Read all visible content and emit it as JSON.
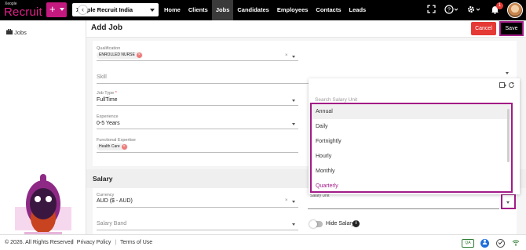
{
  "app": {
    "brand_small": "Xeople",
    "brand": "Recruit",
    "plus_label": "+",
    "org_selector": "Xeople Recruit India"
  },
  "nav": {
    "items": [
      {
        "label": "Home",
        "active": false
      },
      {
        "label": "Clients",
        "active": false
      },
      {
        "label": "Jobs",
        "active": true
      },
      {
        "label": "Candidates",
        "active": false
      },
      {
        "label": "Employees",
        "active": false
      },
      {
        "label": "Contacts",
        "active": false
      },
      {
        "label": "Leads",
        "active": false
      }
    ],
    "notification_count": "1",
    "icons": [
      "fullscreen-icon",
      "help-icon",
      "settings-icon",
      "bell-icon",
      "avatar"
    ]
  },
  "sidebar": {
    "jobs_label": "Jobs",
    "collapse_glyph": "‹"
  },
  "header": {
    "title": "Add Job",
    "cancel_label": "Cancel",
    "save_label": "Save"
  },
  "form": {
    "qualification_label": "Qualification",
    "qualification_chip": "ENROLLED NURSE",
    "skill_placeholder": "Skill",
    "job_type_label": "Job Type",
    "job_type_required": "*",
    "job_type_value": "FullTime",
    "experience_label": "Experience",
    "experience_value": "0-5 Years",
    "functional_expertise_label": "Functional Expertise",
    "functional_expertise_chip": "Health Care",
    "salary_section_title": "Salary",
    "currency_label": "Currency",
    "currency_value": "AUD ($ - AUD)",
    "salary_band_placeholder": "Salary Band",
    "salary_unit_label": "Salary Unit",
    "hide_salary_label": "Hide Salary",
    "clear_glyph": "×"
  },
  "dropdown": {
    "search_placeholder": "Search Salary Unit",
    "options": [
      "Annual",
      "Daily",
      "Fortnightly",
      "Hourly",
      "Monthly",
      "Quarterly"
    ],
    "highlighted": "Annual"
  },
  "footer": {
    "copyright": "© 2026. All Rights Reserved",
    "privacy": "Privacy Policy",
    "terms": "Terms of Use",
    "qa_label": "QA",
    "separator": "|"
  },
  "colors": {
    "brand_pink": "#e31e8a",
    "accent_purple": "#a21b87",
    "cancel_red": "#e53935",
    "nav_bg": "#000000"
  }
}
